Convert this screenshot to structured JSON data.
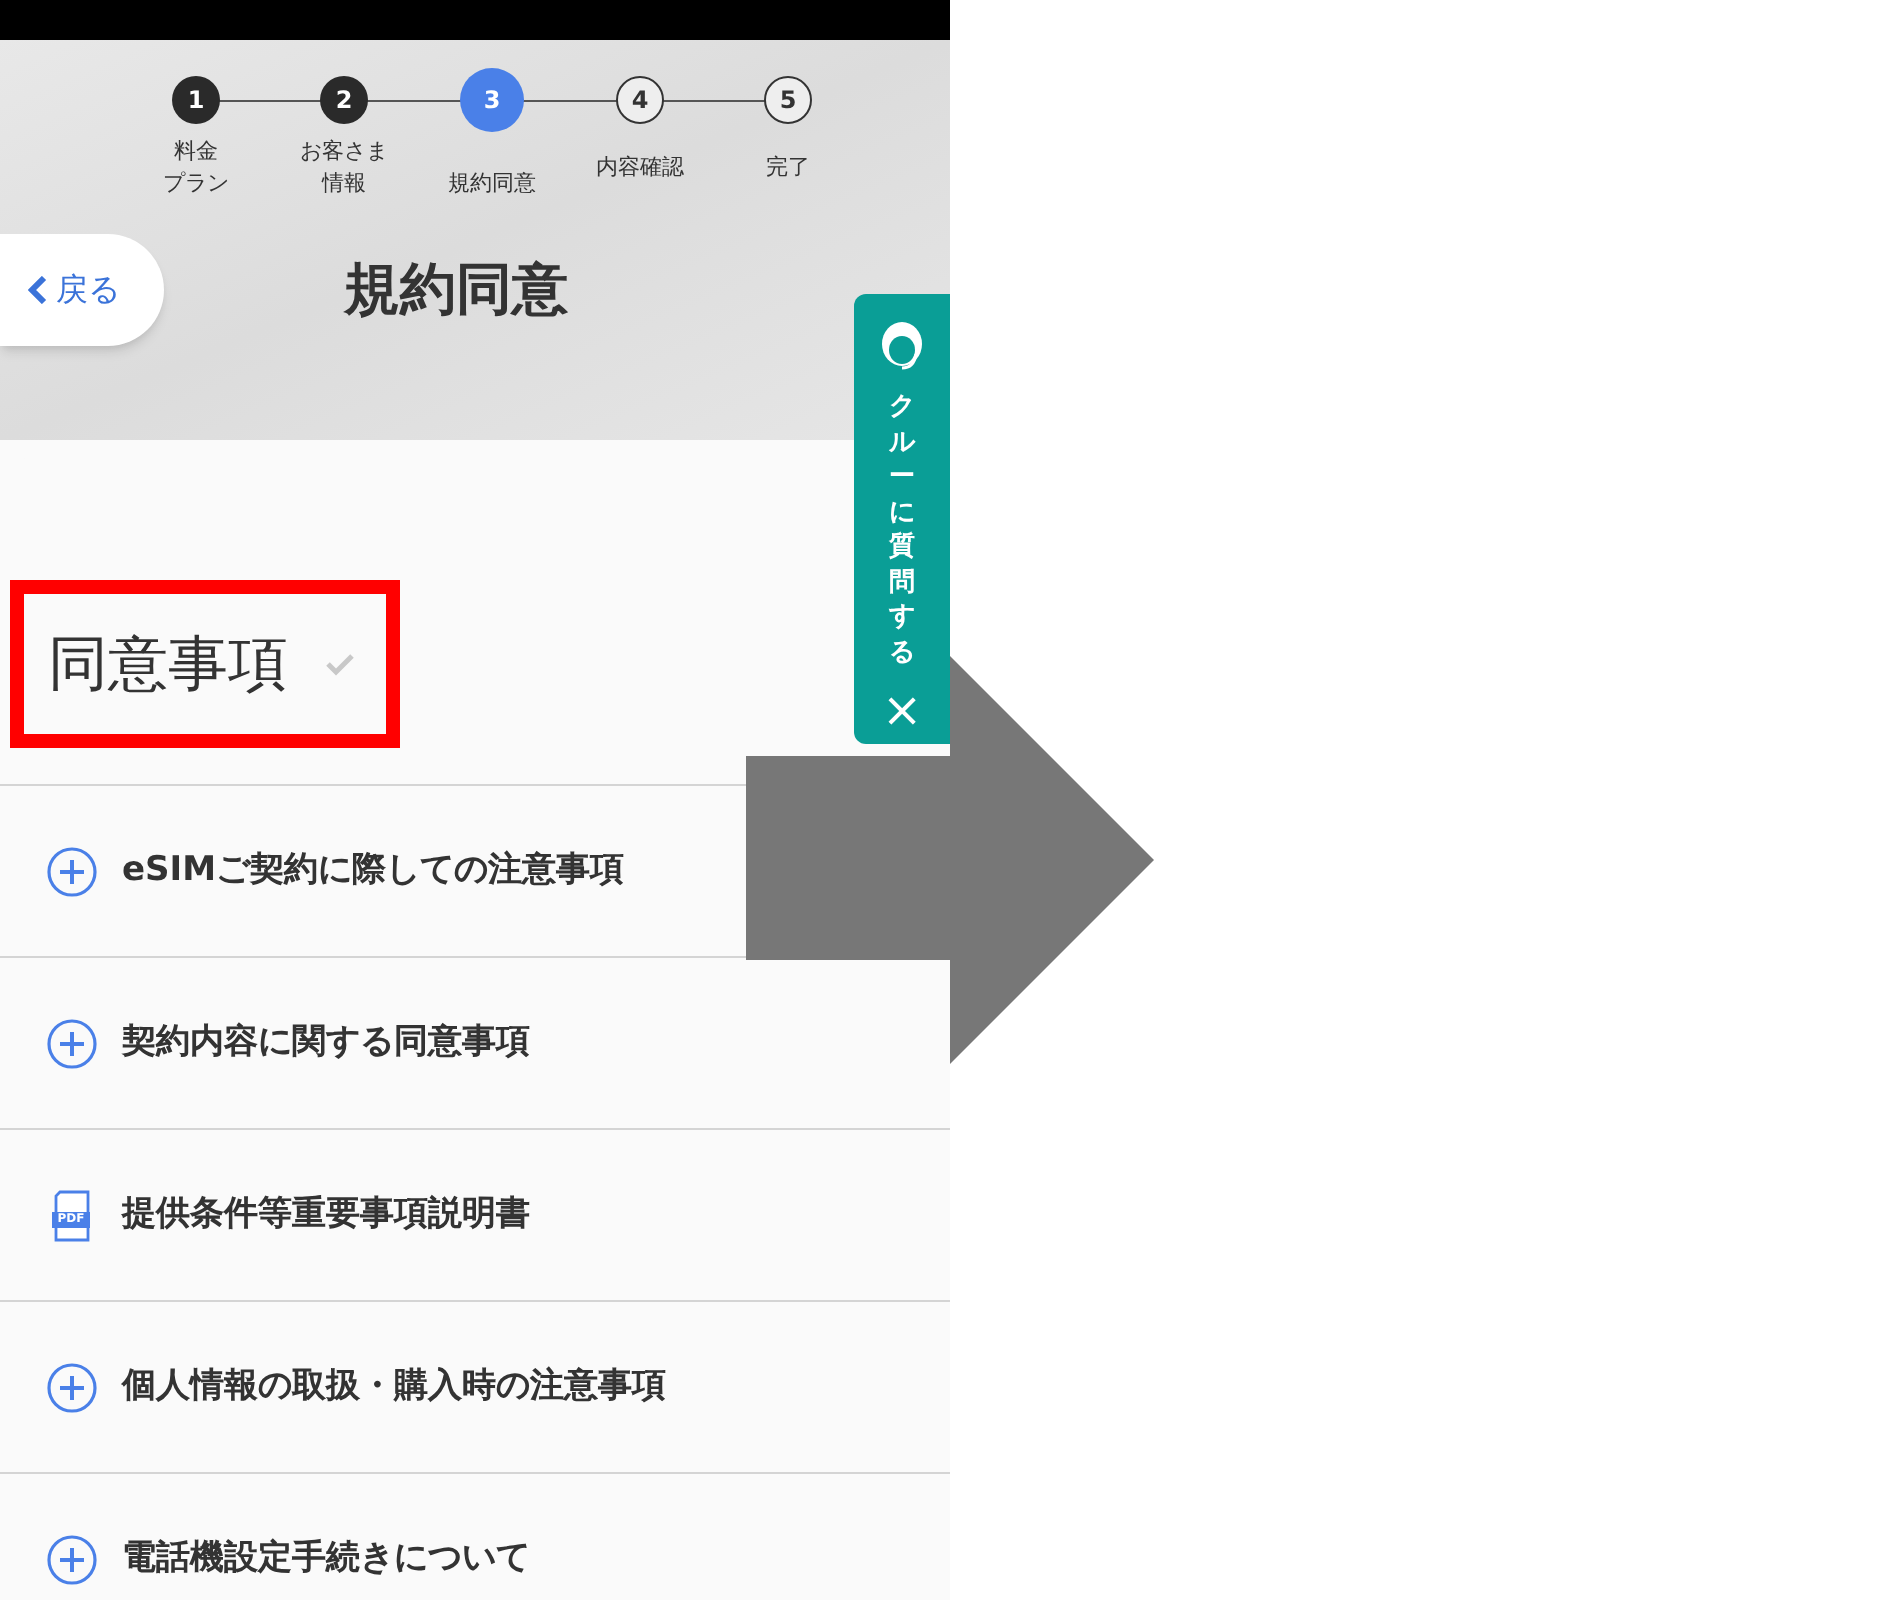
{
  "steps": [
    {
      "number": "1",
      "label_lines": [
        "料金",
        "プラン"
      ],
      "done": true,
      "selected": false
    },
    {
      "number": "2",
      "label_lines": [
        "お客さま",
        "情報"
      ],
      "done": true,
      "selected": false
    },
    {
      "number": "3",
      "label_lines": [
        "規約同意"
      ],
      "selected": true
    },
    {
      "number": "4",
      "label_lines": [
        "内容確認"
      ],
      "done": false,
      "selected": false
    },
    {
      "number": "5",
      "label_lines": [
        "完了"
      ],
      "done": false,
      "selected": false
    }
  ],
  "back_button": {
    "label": "戻る"
  },
  "page_title": "規約同意",
  "chat_tab": {
    "label": "クルーに質問する",
    "close": "×"
  },
  "section": {
    "heading": "同意事項",
    "checked": false,
    "highlighted": true
  },
  "items": [
    {
      "kind": "expand",
      "label": "eSIMご契約に際しての注意事項"
    },
    {
      "kind": "expand",
      "label": "契約内容に関する同意事項"
    },
    {
      "kind": "pdf",
      "icon_text": "PDF",
      "label": "提供条件等重要事項説明書"
    },
    {
      "kind": "expand",
      "label": "個人情報の取扱・購入時の注意事項"
    },
    {
      "kind": "expand",
      "label": "電話機設定手続きについて"
    }
  ],
  "annotation_arrow": true
}
